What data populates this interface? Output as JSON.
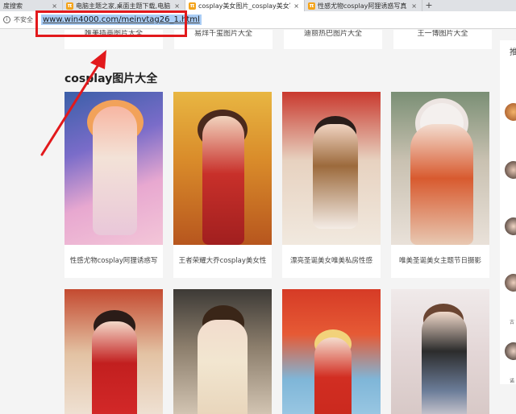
{
  "browser": {
    "tabs": [
      {
        "title": "度搜索",
        "active": false,
        "has_favicon": false
      },
      {
        "title": "电脑主题之家,桌面主题下载,电脑",
        "active": false,
        "has_favicon": true
      },
      {
        "title": "cosplay美女图片_cosplay美女写",
        "active": true,
        "has_favicon": true
      },
      {
        "title": "性感尤物cosplay阿狸诱惑写真",
        "active": false,
        "has_favicon": true
      }
    ],
    "new_tab_symbol": "+",
    "close_symbol": "×",
    "security_label": "不安全",
    "url": "www.win4000.com/meinvtag26_1.html"
  },
  "page": {
    "top_cards": [
      "唯美插画图片大全",
      "易烊千玺图片大全",
      "迪丽热巴图片大全",
      "王一博图片大全"
    ],
    "section_title": "cosplay图片大全",
    "items": [
      {
        "caption": "性感尤物cosplay阿狸诱惑写"
      },
      {
        "caption": "王者荣耀大乔cosplay美女性"
      },
      {
        "caption": "漂亮圣诞美女唯美私房性感"
      },
      {
        "caption": "唯美圣诞美女主题节日摄影"
      },
      {
        "caption": ""
      },
      {
        "caption": ""
      },
      {
        "caption": ""
      },
      {
        "caption": ""
      }
    ],
    "sidebar_heading": "推",
    "sidebar_texts": [
      "古",
      "诺"
    ]
  },
  "colors": {
    "annotation_red": "#e2191c",
    "url_highlight": "#aacdf5",
    "favicon_orange": "#f4a41b"
  }
}
